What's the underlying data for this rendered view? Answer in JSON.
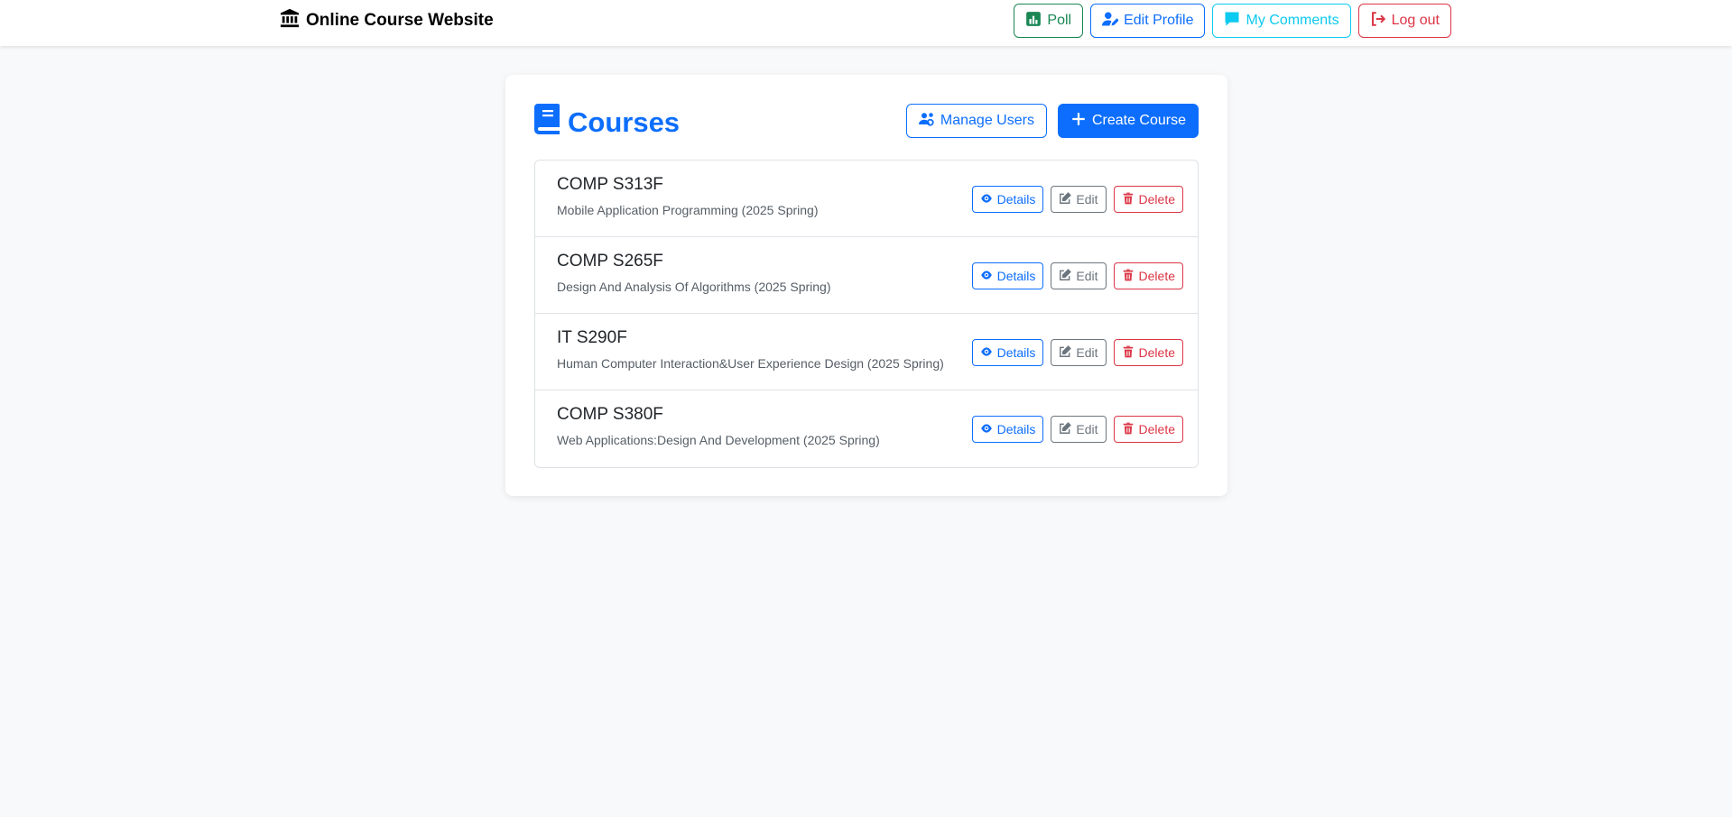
{
  "navbar": {
    "brand": "Online Course Website",
    "buttons": {
      "poll": "Poll",
      "edit_profile": "Edit Profile",
      "my_comments": "My Comments",
      "log_out": "Log out"
    }
  },
  "main": {
    "title": "Courses",
    "manage_users": "Manage Users",
    "create_course": "Create Course",
    "courses": [
      {
        "code": "COMP S313F",
        "description": "Mobile Application Programming (2025 Spring)"
      },
      {
        "code": "COMP S265F",
        "description": "Design And Analysis Of Algorithms (2025 Spring)"
      },
      {
        "code": "IT S290F",
        "description": "Human Computer Interaction&User Experience Design (2025 Spring)"
      },
      {
        "code": "COMP S380F",
        "description": "Web Applications:Design And Development (2025 Spring)"
      }
    ],
    "row_actions": {
      "details": "Details",
      "edit": "Edit",
      "delete": "Delete"
    }
  },
  "colors": {
    "primary": "#0d6efd",
    "success": "#198754",
    "info": "#0dcaf0",
    "danger": "#dc3545",
    "secondary": "#6c757d"
  }
}
